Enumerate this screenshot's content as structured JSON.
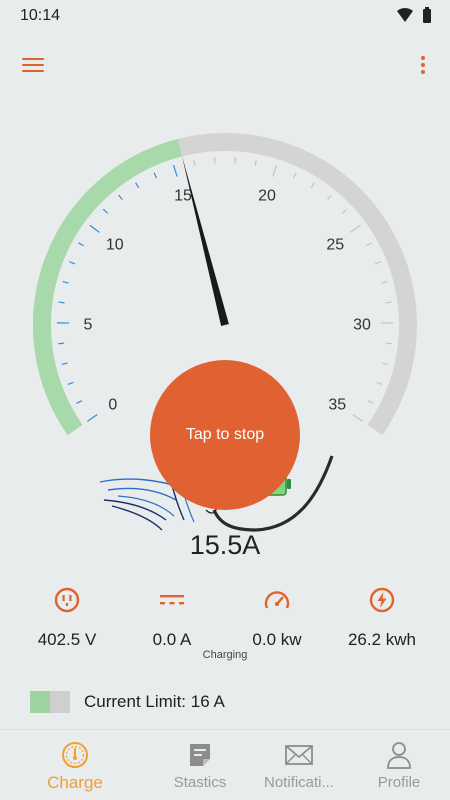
{
  "status_bar": {
    "time": "10:14",
    "icons": [
      "wifi-icon",
      "battery-icon"
    ]
  },
  "app_bar": {
    "menu_icon": "hamburger-menu-icon",
    "more_icon": "more-vertical-icon"
  },
  "gauge": {
    "ticks": [
      "0",
      "5",
      "10",
      "15",
      "20",
      "25",
      "30",
      "35"
    ],
    "min": 0,
    "max": 35,
    "value": 15.5,
    "fill_color": "#a8d9aa",
    "track_color": "#d4d4d4",
    "needle_color": "#1a1a1a"
  },
  "button": {
    "label": "Tap to stop",
    "color": "#e06233"
  },
  "reading": {
    "current": "15.5A"
  },
  "status": {
    "label": "Charging",
    "battery_icon": "battery-charging-icon"
  },
  "stats": [
    {
      "icon": "outlet-icon",
      "value": "402.5 V"
    },
    {
      "icon": "dc-current-icon",
      "value": "0.0 A"
    },
    {
      "icon": "speedometer-icon",
      "value": "0.0 kw"
    },
    {
      "icon": "bolt-icon",
      "value": "26.2 kwh"
    }
  ],
  "limit": {
    "text": "Current Limit: 16 A",
    "fraction": 0.5
  },
  "nav": {
    "items": [
      {
        "label": "Charge",
        "icon": "gauge-icon",
        "active": true
      },
      {
        "label": "Stastics",
        "icon": "note-icon",
        "active": false
      },
      {
        "label": "Notificati...",
        "icon": "mail-icon",
        "active": false
      },
      {
        "label": "Profile",
        "icon": "person-icon",
        "active": false
      }
    ],
    "active_color": "#f0a031",
    "inactive_color": "#9a9a9a"
  },
  "colors": {
    "accent": "#e0622e",
    "background": "#e9ecec"
  }
}
